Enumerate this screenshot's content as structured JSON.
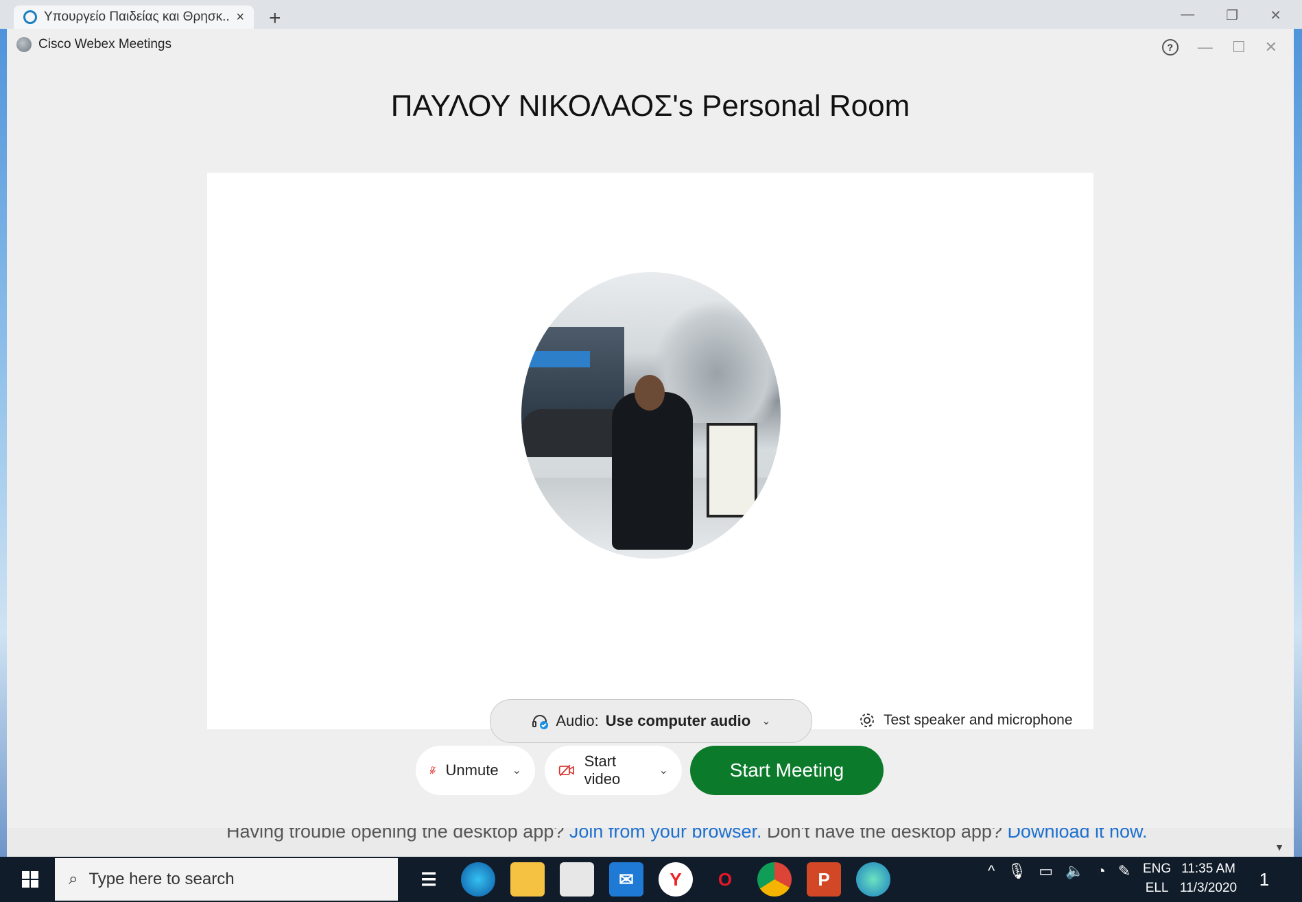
{
  "browser": {
    "tab_title": "Υπουργείο Παιδείας και Θρησκ...",
    "tab_close": "×",
    "new_tab": "+"
  },
  "app": {
    "title": "Cisco Webex Meetings",
    "help": "?"
  },
  "room": {
    "title": "ΠΑΥΛΟΥ ΝΙΚΟΛΑΟΣ's Personal Room"
  },
  "audio": {
    "label": "Audio:",
    "value": "Use computer audio",
    "test_label": "Test speaker and microphone"
  },
  "controls": {
    "unmute_label": "Unmute",
    "video_label": "Start video",
    "start_meeting_label": "Start Meeting"
  },
  "trouble": {
    "prefix": "Having trouble opening the desktop app?",
    "join_link": "Join from your browser.",
    "middle": "Don't have the desktop app?",
    "download_link": "Download it now."
  },
  "taskbar": {
    "search_placeholder": "Type here to search",
    "lang_top": "ENG",
    "lang_bottom": "ELL",
    "time": "11:35 AM",
    "date": "11/3/2020",
    "notification_count": "1"
  }
}
